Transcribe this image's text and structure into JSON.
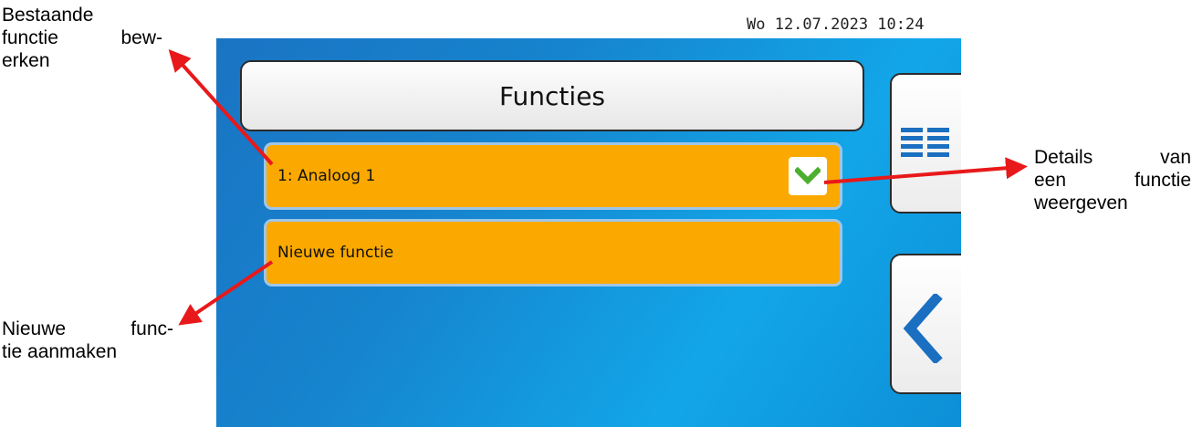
{
  "status_bar": {
    "datetime": "Wo 12.07.2023 10:24"
  },
  "screen": {
    "title": "Functies",
    "items": [
      {
        "label": "1: Analoog 1",
        "has_expand": true
      },
      {
        "label": "Nieuwe functie",
        "has_expand": false
      }
    ],
    "side_buttons": [
      {
        "icon": "list-view-icon"
      },
      {
        "icon": "back-chevron-icon"
      }
    ]
  },
  "annotations": {
    "top_left": [
      "Bestaande",
      "functie bew-",
      "erken"
    ],
    "bottom_left": [
      "Nieuwe func-",
      "tie aanmaken"
    ],
    "right": [
      "Details van",
      "een functie",
      "weergeven"
    ]
  },
  "colors": {
    "screen_blue": "#1684ce",
    "item_orange": "#fba900",
    "check_green": "#4caf2f",
    "icon_blue": "#1b6fc0",
    "arrow_red": "#e8191a"
  }
}
